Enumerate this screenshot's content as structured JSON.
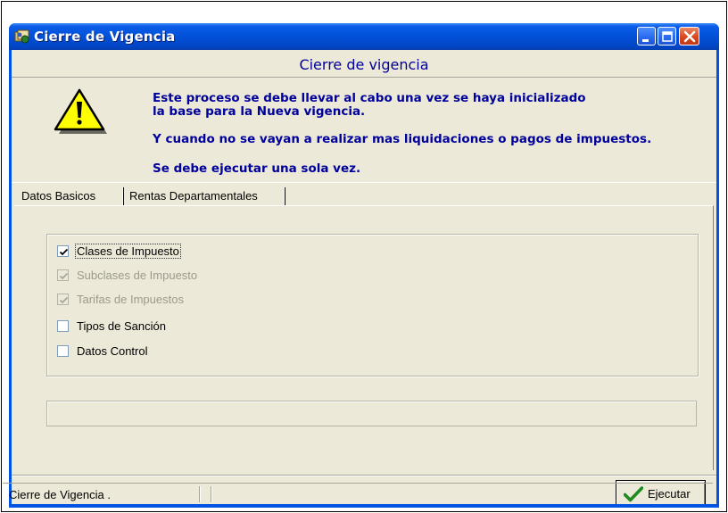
{
  "window": {
    "title": "Cierre de Vigencia"
  },
  "header": {
    "title": "Cierre de vigencia",
    "messages": [
      "Este proceso se debe llevar al cabo una vez se haya inicializado",
      "la base para la Nueva vigencia.",
      "Y cuando no se vayan a realizar mas liquidaciones o pagos de impuestos.",
      "Se debe ejecutar una sola vez."
    ],
    "icon": "warning-icon"
  },
  "tabs": [
    {
      "label": "Datos Basicos",
      "selected": true
    },
    {
      "label": "Rentas Departamentales",
      "selected": false
    }
  ],
  "checkboxes": [
    {
      "label": "Clases de Impuesto",
      "checked": true,
      "enabled": true
    },
    {
      "label": "Subclases de Impuesto",
      "checked": true,
      "enabled": false
    },
    {
      "label": "Tarifas de Impuestos",
      "checked": true,
      "enabled": false
    },
    {
      "label": "Tipos de Sanción",
      "checked": false,
      "enabled": true
    },
    {
      "label": "Datos Control",
      "checked": false,
      "enabled": true
    }
  ],
  "progress": {
    "value": 0
  },
  "actions": {
    "execute_label": "Ejecutar"
  },
  "statusbar": {
    "text": "Cierre de Vigencia ."
  },
  "colors": {
    "title_bar": "#0054e3",
    "header_text": "#00009c",
    "client_bg": "#ece9d8"
  }
}
